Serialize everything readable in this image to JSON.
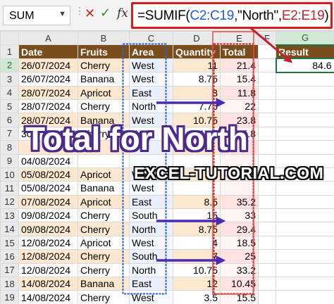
{
  "formula_bar": {
    "name_box": "SUM",
    "formula_parts": [
      {
        "text": "=SUMIF(",
        "color": "black"
      },
      {
        "text": "C2:C19",
        "color": "blue"
      },
      {
        "text": ",\"North\",",
        "color": "black"
      },
      {
        "text": "E2:E19",
        "color": "red"
      },
      {
        "text": ")",
        "color": "black"
      }
    ]
  },
  "columns": [
    "A",
    "B",
    "C",
    "D",
    "E",
    "F",
    "G"
  ],
  "headers": {
    "date": "Date",
    "fruits": "Fruits",
    "area": "Area",
    "quantity": "Quantity",
    "total": "Total",
    "result": "Result"
  },
  "rows": [
    {
      "n": "2",
      "date": "26/07/2024",
      "fruit": "Cherry",
      "area": "West",
      "qty": "11",
      "total": "21.4"
    },
    {
      "n": "3",
      "date": "26/07/2024",
      "fruit": "Banana",
      "area": "West",
      "qty": "8.75",
      "total": "15.4"
    },
    {
      "n": "4",
      "date": "28/07/2024",
      "fruit": "Apricot",
      "area": "East",
      "qty": "3",
      "total": "11.8"
    },
    {
      "n": "5",
      "date": "28/07/2024",
      "fruit": "Cherry",
      "area": "North",
      "qty": "7.75",
      "total": "22"
    },
    {
      "n": "6",
      "date": "28/07/2024",
      "fruit": "Banana",
      "area": "West",
      "qty": "10.75",
      "total": "23.8"
    },
    {
      "n": "7",
      "date": "30/07/2024",
      "fruit": "Cherry",
      "area": "West",
      "qty": "11.5",
      "total": "15.8"
    },
    {
      "n": "8",
      "date": "",
      "fruit": "",
      "area": "",
      "qty": "",
      "total": ""
    },
    {
      "n": "9",
      "date": "04/08/2024",
      "fruit": "",
      "area": "",
      "qty": "",
      "total": ""
    },
    {
      "n": "10",
      "date": "05/08/2024",
      "fruit": "Apricot",
      "area": "West",
      "qty": "",
      "total": ""
    },
    {
      "n": "11",
      "date": "05/08/2024",
      "fruit": "Banana",
      "area": "West",
      "qty": "",
      "total": ""
    },
    {
      "n": "12",
      "date": "07/08/2024",
      "fruit": "Apricot",
      "area": "East",
      "qty": "8.5",
      "total": "35.2"
    },
    {
      "n": "13",
      "date": "09/08/2024",
      "fruit": "Cherry",
      "area": "South",
      "qty": "15",
      "total": "33"
    },
    {
      "n": "14",
      "date": "09/08/2024",
      "fruit": "Cherry",
      "area": "North",
      "qty": "8.75",
      "total": "29.4"
    },
    {
      "n": "15",
      "date": "12/08/2024",
      "fruit": "Apricot",
      "area": "West",
      "qty": "4",
      "total": "18.5"
    },
    {
      "n": "16",
      "date": "12/08/2024",
      "fruit": "Cherry",
      "area": "South",
      "qty": "7",
      "total": "25"
    },
    {
      "n": "17",
      "date": "12/08/2024",
      "fruit": "Cherry",
      "area": "North",
      "qty": "10.75",
      "total": "33.2"
    },
    {
      "n": "18",
      "date": "14/08/2024",
      "fruit": "Banana",
      "area": "East",
      "qty": "12",
      "total": "10.45"
    },
    {
      "n": "19",
      "date": "14/08/2024",
      "fruit": "Cherry",
      "area": "West",
      "qty": "3.5",
      "total": "15.5"
    }
  ],
  "result_value": "84.6",
  "overlay_title": "Total for North",
  "watermark": "EXCEL-TUTORIAL.COM",
  "colors": {
    "header_bg": "#7a4d1c",
    "accent_red": "#d21f1f",
    "accent_blue": "#2f5fd1",
    "arrow_purple": "#4b2bb0",
    "excel_green": "#217346"
  }
}
